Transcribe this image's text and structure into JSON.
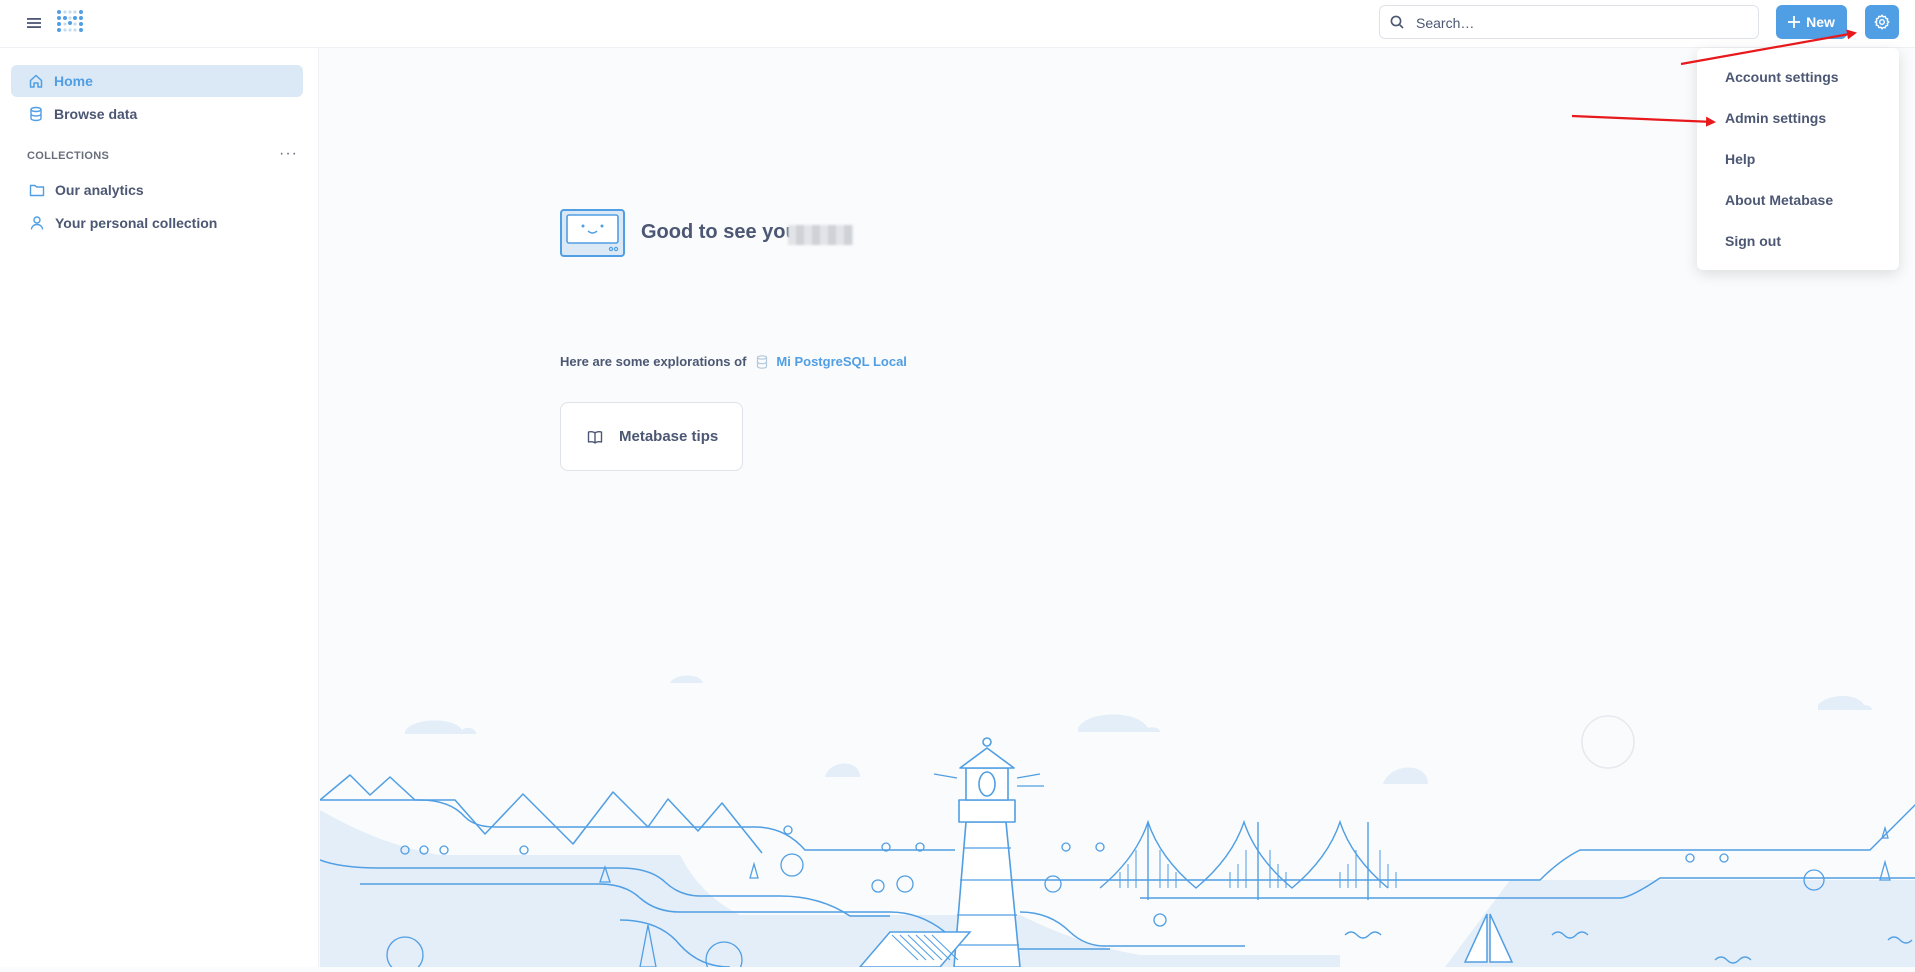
{
  "header": {
    "search_placeholder": "Search…",
    "new_label": "New"
  },
  "sidebar": {
    "items": [
      {
        "label": "Home",
        "icon": "home-icon",
        "active": true
      },
      {
        "label": "Browse data",
        "icon": "database-icon"
      }
    ],
    "collections_title": "COLLECTIONS",
    "collections": [
      {
        "label": "Our analytics",
        "icon": "folder-icon"
      },
      {
        "label": "Your personal collection",
        "icon": "person-icon"
      }
    ]
  },
  "main": {
    "greeting": "Good to see you,",
    "explorations_text": "Here are some explorations of",
    "database_name": "Mi PostgreSQL Local",
    "tips_card_label": "Metabase tips"
  },
  "settings_menu": {
    "items": [
      "Account settings",
      "Admin settings",
      "Help",
      "About Metabase",
      "Sign out"
    ]
  },
  "colors": {
    "brand": "#509ee3",
    "text": "#4c5773",
    "annotation_arrow": "#e8191c"
  }
}
